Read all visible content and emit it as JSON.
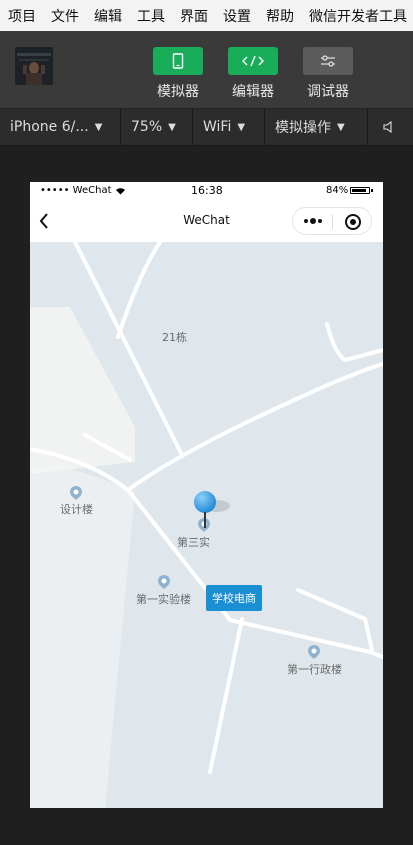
{
  "menu": [
    "项目",
    "文件",
    "编辑",
    "工具",
    "界面",
    "设置",
    "帮助",
    "微信开发者工具"
  ],
  "toolbar": {
    "simulator_label": "模拟器",
    "editor_label": "编辑器",
    "debugger_label": "调试器",
    "simulator_color": "#19ad5a",
    "editor_color": "#19ad5a",
    "debugger_color": "#5c5c5c"
  },
  "devbar": {
    "device": "iPhone 6/...",
    "zoom": "75%",
    "network": "WiFi",
    "operation": "模拟操作"
  },
  "status": {
    "carrier": "••••• WeChat",
    "time": "16:38",
    "battery": "84%"
  },
  "nav": {
    "title": "WeChat"
  },
  "map": {
    "labels": {
      "building21": "21栋",
      "design": "设计楼",
      "lab3": "第三实",
      "lab1": "第一实验楼",
      "admin1": "第一行政楼"
    },
    "callout": "学校电商"
  }
}
